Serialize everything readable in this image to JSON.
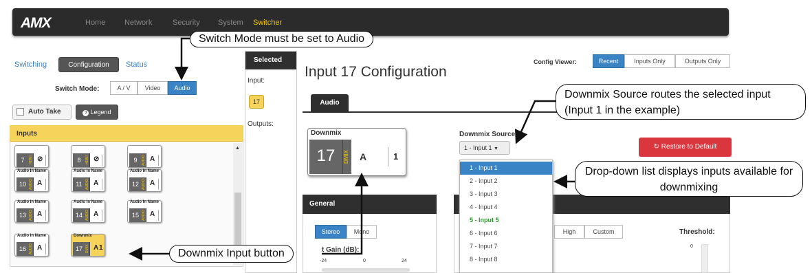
{
  "app": {
    "logo": "AMX"
  },
  "nav": {
    "items": [
      "Home",
      "Network",
      "Security",
      "System",
      "Switcher"
    ],
    "active_index": 4
  },
  "left": {
    "tabs": [
      "Switching",
      "Configuration",
      "Status"
    ],
    "switch_mode_label": "Switch Mode:",
    "switch_mode_options": [
      "A / V",
      "Video",
      "Audio"
    ],
    "auto_take_label": "Auto Take",
    "legend_label": "Legend",
    "inputs_header": "Inputs",
    "tiles": [
      {
        "name": "",
        "num": "7",
        "tag": "HDMI",
        "val": "⊘"
      },
      {
        "name": "",
        "num": "8",
        "tag": "HDMI",
        "val": "⊘"
      },
      {
        "name": "",
        "num": "9",
        "tag": "AUDIO",
        "val": "A"
      },
      {
        "name": "Audio In Name",
        "num": "10",
        "tag": "AUDIO",
        "val": "A"
      },
      {
        "name": "Audio In Name",
        "num": "11",
        "tag": "AUDIO",
        "val": "A"
      },
      {
        "name": "Audio In Name",
        "num": "12",
        "tag": "AUDIO",
        "val": "A"
      },
      {
        "name": "Audio In Name",
        "num": "13",
        "tag": "AUDIO",
        "val": "A"
      },
      {
        "name": "Audio In Name",
        "num": "14",
        "tag": "AUDIO",
        "val": "A"
      },
      {
        "name": "Audio In Name",
        "num": "15",
        "tag": "AUDIO",
        "val": "A"
      },
      {
        "name": "Audio In Name",
        "num": "16",
        "tag": "AUDIO",
        "val": "A"
      },
      {
        "name": "Downmix",
        "num": "17",
        "tag": "DMIX",
        "val": "A",
        "extra": "1"
      }
    ]
  },
  "selected": {
    "header": "Selected",
    "input_label": "Input:",
    "input_value": "17",
    "outputs_label": "Outputs:"
  },
  "main": {
    "title": "Input 17 Configuration",
    "config_viewer_label": "Config Viewer:",
    "config_viewer_options": [
      "Recent",
      "Inputs Only",
      "Outputs Only"
    ],
    "tab": "Audio",
    "downmix_card": {
      "title": "Downmix",
      "num": "17",
      "tag": "DMIX",
      "val": "A",
      "extra": "1"
    },
    "downmix_source_label": "Downmix Source:",
    "downmix_source_value": "1 - Input 1",
    "restore_label": "Restore to Default",
    "dropdown_items": [
      "1 - Input 1",
      "2 - Input 2",
      "3 - Input 3",
      "4 - Input 4",
      "5 - Input 5",
      "6 - Input 6",
      "7 - Input 7",
      "8 - Input 8"
    ],
    "general_header": "General",
    "stereo_label": "Stereo",
    "mono_label": "Mono",
    "gain_label": "t Gain (dB):",
    "gain_ticks": [
      "-24",
      "0",
      "24"
    ],
    "eq_options": [
      "High",
      "Custom"
    ],
    "threshold_label": "Threshold:",
    "threshold_tick": "0"
  },
  "callouts": {
    "switch_mode": "Switch Mode must be set to Audio",
    "downmix_source": "Downmix Source routes the selected input (Input 1 in the example)",
    "dropdown_list": "Drop-down list displays inputs available for downmixing",
    "downmix_input": "Downmix Input button"
  },
  "colors": {
    "accent": "#3a83c4",
    "highlight": "#f5c400",
    "restore": "#d9363e"
  }
}
